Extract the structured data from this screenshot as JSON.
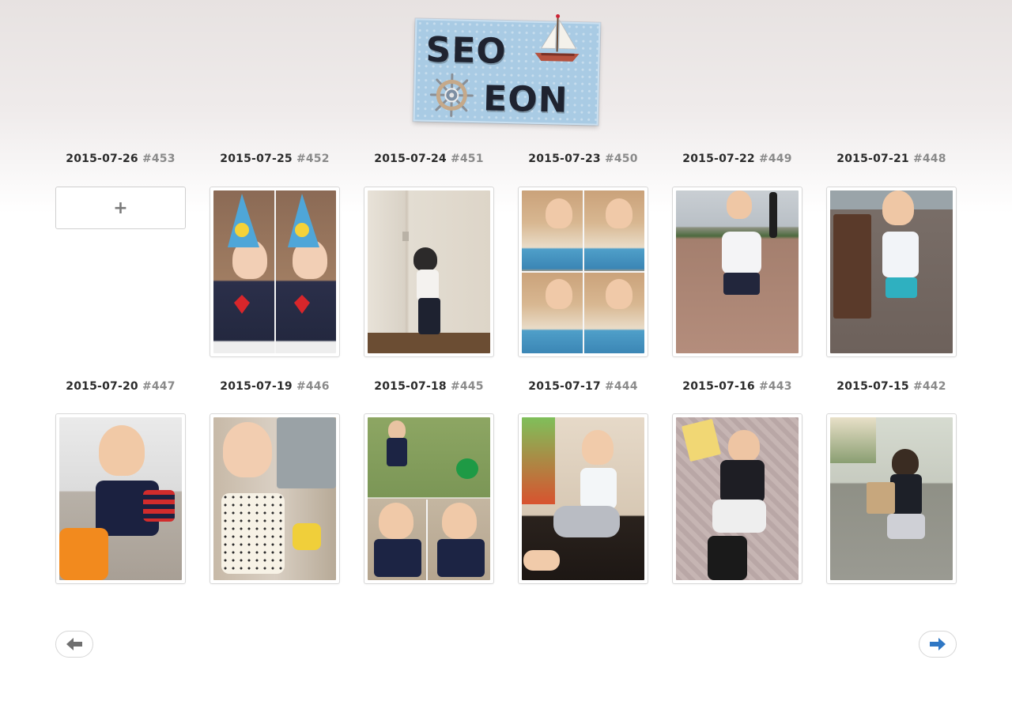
{
  "logo": {
    "line1": "SEO",
    "line2": "EON"
  },
  "add_button": {
    "label": "+"
  },
  "entries": [
    {
      "date": "2015-07-26",
      "num": "#453"
    },
    {
      "date": "2015-07-25",
      "num": "#452"
    },
    {
      "date": "2015-07-24",
      "num": "#451"
    },
    {
      "date": "2015-07-23",
      "num": "#450"
    },
    {
      "date": "2015-07-22",
      "num": "#449"
    },
    {
      "date": "2015-07-21",
      "num": "#448"
    },
    {
      "date": "2015-07-20",
      "num": "#447"
    },
    {
      "date": "2015-07-19",
      "num": "#446"
    },
    {
      "date": "2015-07-18",
      "num": "#445"
    },
    {
      "date": "2015-07-17",
      "num": "#444"
    },
    {
      "date": "2015-07-16",
      "num": "#443"
    },
    {
      "date": "2015-07-15",
      "num": "#442"
    }
  ],
  "nav": {
    "prev_icon": "arrow-left-icon",
    "next_icon": "arrow-right-icon",
    "prev_color": "#6f6f6f",
    "next_color": "#2f77c4"
  }
}
